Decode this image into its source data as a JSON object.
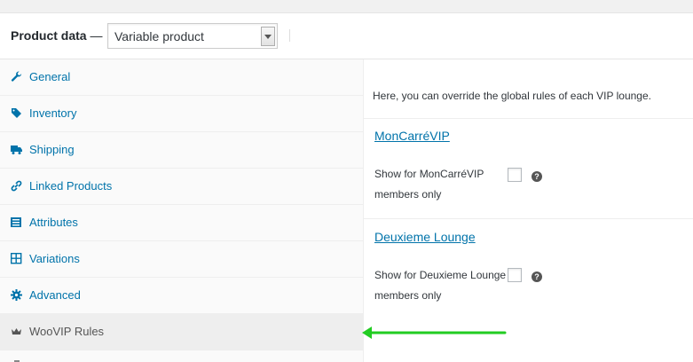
{
  "header": {
    "label": "Product data",
    "dash": " —",
    "product_type": "Variable product"
  },
  "sidebar": {
    "items": [
      {
        "label": "General",
        "icon": "wrench-icon"
      },
      {
        "label": "Inventory",
        "icon": "tag-icon"
      },
      {
        "label": "Shipping",
        "icon": "truck-icon"
      },
      {
        "label": "Linked Products",
        "icon": "link-icon"
      },
      {
        "label": "Attributes",
        "icon": "list-icon"
      },
      {
        "label": "Variations",
        "icon": "grid-icon"
      },
      {
        "label": "Advanced",
        "icon": "gear-icon"
      },
      {
        "label": "WooVIP Rules",
        "icon": "crown-icon",
        "active": true
      }
    ]
  },
  "panel": {
    "intro": "Here, you can override the global rules of each VIP lounge.",
    "lounges": [
      {
        "name": "MonCarréVIP",
        "field_line1": "Show for MonCarréVIP",
        "field_line2": "members only",
        "checked": false
      },
      {
        "name": "Deuxieme Lounge",
        "field_line1": "Show for Deuxieme Lounge",
        "field_line2": "members only",
        "checked": false
      }
    ],
    "help_glyph": "?"
  },
  "colors": {
    "link": "#0073aa",
    "annotation_arrow": "#22cc22"
  }
}
